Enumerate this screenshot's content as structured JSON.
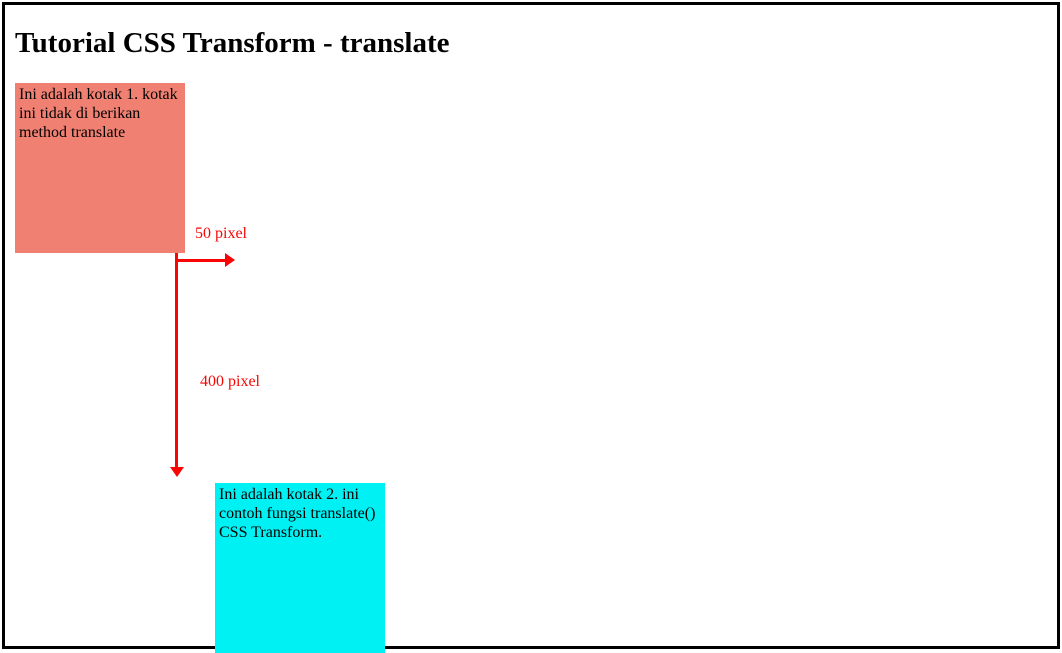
{
  "title": "Tutorial CSS Transform - translate",
  "box1_text": "Ini adalah kotak 1. kotak ini tidak di berikan method translate",
  "box2_text": "Ini adalah kotak 2. ini contoh fungsi translate() CSS Transform.",
  "label_x": "50 pixel",
  "label_y": "400 pixel"
}
